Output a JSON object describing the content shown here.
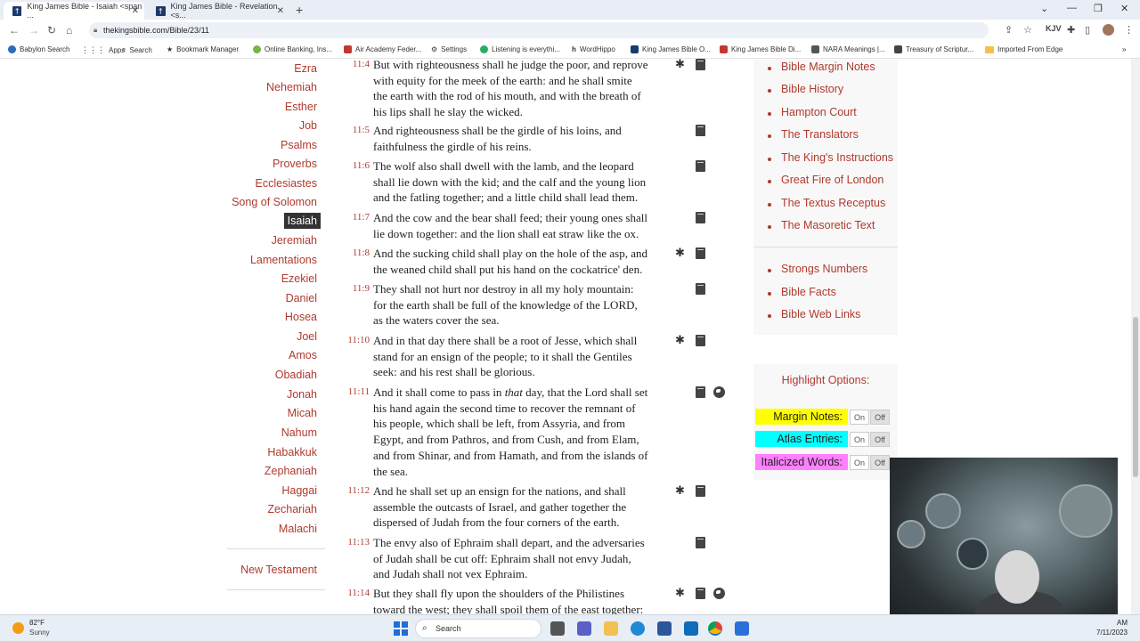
{
  "browser": {
    "tabs": [
      {
        "title": "King James Bible - Isaiah <span ...",
        "active": true
      },
      {
        "title": "King James Bible - Revelation <s...",
        "active": false
      }
    ],
    "url": "thekingsbible.com/Bible/23/11",
    "bookmarks": [
      {
        "label": "Babylon Search",
        "color": "#2c6bb7"
      },
      {
        "label": "Apps",
        "color": "#555555"
      },
      {
        "label": "Search",
        "color": "#555555"
      },
      {
        "label": "Bookmark Manager",
        "color": "#555555"
      },
      {
        "label": "Online Banking, Ins...",
        "color": "#7bb241"
      },
      {
        "label": "Air Academy Feder...",
        "color": "#c0392b"
      },
      {
        "label": "Settings",
        "color": "#555555"
      },
      {
        "label": "Listening is everythi...",
        "color": "#27ae60"
      },
      {
        "label": "WordHippo",
        "color": "#333333"
      },
      {
        "label": "King James Bible O...",
        "color": "#1a3a6b"
      },
      {
        "label": "King James Bible Di...",
        "color": "#c0392b"
      },
      {
        "label": "NARA Meanings |...",
        "color": "#555555"
      },
      {
        "label": "Treasury of Scriptur...",
        "color": "#444444"
      },
      {
        "label": "Imported From Edge",
        "color": "#f4c150"
      }
    ]
  },
  "books": [
    {
      "name": "Ezra",
      "active": false
    },
    {
      "name": "Nehemiah",
      "active": false
    },
    {
      "name": "Esther",
      "active": false
    },
    {
      "name": "Job",
      "active": false
    },
    {
      "name": "Psalms",
      "active": false
    },
    {
      "name": "Proverbs",
      "active": false
    },
    {
      "name": "Ecclesiastes",
      "active": false
    },
    {
      "name": "Song of Solomon",
      "active": false
    },
    {
      "name": "Isaiah",
      "active": true
    },
    {
      "name": "Jeremiah",
      "active": false
    },
    {
      "name": "Lamentations",
      "active": false
    },
    {
      "name": "Ezekiel",
      "active": false
    },
    {
      "name": "Daniel",
      "active": false
    },
    {
      "name": "Hosea",
      "active": false
    },
    {
      "name": "Joel",
      "active": false
    },
    {
      "name": "Amos",
      "active": false
    },
    {
      "name": "Obadiah",
      "active": false
    },
    {
      "name": "Jonah",
      "active": false
    },
    {
      "name": "Micah",
      "active": false
    },
    {
      "name": "Nahum",
      "active": false
    },
    {
      "name": "Habakkuk",
      "active": false
    },
    {
      "name": "Zephaniah",
      "active": false
    },
    {
      "name": "Haggai",
      "active": false
    },
    {
      "name": "Zechariah",
      "active": false
    },
    {
      "name": "Malachi",
      "active": false
    }
  ],
  "new_testament_label": "New Testament",
  "verses": [
    {
      "num": "11:4",
      "lines": [
        "But with righteousness shall he judge the poor, and reprove",
        "with equity for the meek of the earth: and he shall smite",
        "the earth with the rod of his mouth, and with the breath of",
        "his lips shall he slay the wicked."
      ],
      "icons": [
        "asterisk",
        "book"
      ]
    },
    {
      "num": "11:5",
      "lines": [
        "And righteousness shall be the girdle of his loins, and",
        "faithfulness the girdle of his reins."
      ],
      "icons": [
        "book"
      ]
    },
    {
      "num": "11:6",
      "lines": [
        "The wolf also shall dwell with the lamb, and the leopard",
        "shall lie down with the kid; and the calf and the young lion",
        "and the fatling together; and a little child shall lead them."
      ],
      "icons": [
        "book"
      ]
    },
    {
      "num": "11:7",
      "lines": [
        "And the cow and the bear shall feed; their young ones shall",
        "lie down together: and the lion shall eat straw like the ox."
      ],
      "icons": [
        "book"
      ]
    },
    {
      "num": "11:8",
      "lines": [
        "And the sucking child shall play on the hole of the asp, and",
        "the weaned child shall put his hand on the cockatrice' den."
      ],
      "icons": [
        "asterisk",
        "book"
      ]
    },
    {
      "num": "11:9",
      "lines": [
        "They shall not hurt nor destroy in all my holy mountain:",
        "for the earth shall be full of the knowledge of the LORD,",
        "as the waters cover the sea."
      ],
      "icons": [
        "book"
      ]
    },
    {
      "num": "11:10",
      "lines": [
        "And in that day there shall be a root of Jesse, which shall",
        "stand for an ensign of the people; to it shall the Gentiles",
        "seek: and his rest shall be glorious."
      ],
      "icons": [
        "asterisk",
        "book"
      ]
    },
    {
      "num": "11:11",
      "lines": [
        "And it shall come to pass in that day, that the Lord shall set",
        "his hand again the second time to recover the remnant of",
        "his people, which shall be left, from Assyria, and from",
        "Egypt, and from Pathros, and from Cush, and from Elam,",
        "and from Shinar, and from Hamath, and from the islands of",
        "the sea."
      ],
      "icons": [
        "book",
        "globe"
      ]
    },
    {
      "num": "11:12",
      "lines": [
        "And he shall set up an ensign for the nations, and shall",
        "assemble the outcasts of Israel, and gather together the",
        "dispersed of Judah from the four corners of the earth."
      ],
      "icons": [
        "asterisk",
        "book"
      ]
    },
    {
      "num": "11:13",
      "lines": [
        "The envy also of Ephraim shall depart, and the adversaries",
        "of Judah shall be cut off: Ephraim shall not envy Judah,",
        "and Judah shall not vex Ephraim."
      ],
      "icons": [
        "book"
      ]
    },
    {
      "num": "11:14",
      "lines": [
        "But they shall fly upon the shoulders of the Philistines",
        "toward the west; they shall spoil them of the east together:"
      ],
      "icons": [
        "asterisk",
        "book",
        "globe"
      ]
    }
  ],
  "sidebar_links": [
    "Bible Margin Notes",
    "Bible History",
    "Hampton Court",
    "The Translators",
    "The King's Instructions",
    "Great Fire of London",
    "The Textus Receptus",
    "The Masoretic Text"
  ],
  "sidebar_links_2": [
    "Strongs Numbers",
    "Bible Facts",
    "Bible Web Links"
  ],
  "highlight": {
    "title": "Highlight Options:",
    "on_label": "On",
    "off_label": "Off",
    "rows": [
      {
        "label": "Margin Notes:",
        "color": "#ffff00"
      },
      {
        "label": "Atlas Entries:",
        "color": "#00ffff"
      },
      {
        "label": "Italicized Words:",
        "color": "#ff80ff"
      }
    ]
  },
  "taskbar": {
    "temp": "82°F",
    "weather": "Sunny",
    "search_placeholder": "Search",
    "time": "AM",
    "date": "7/11/2023"
  }
}
